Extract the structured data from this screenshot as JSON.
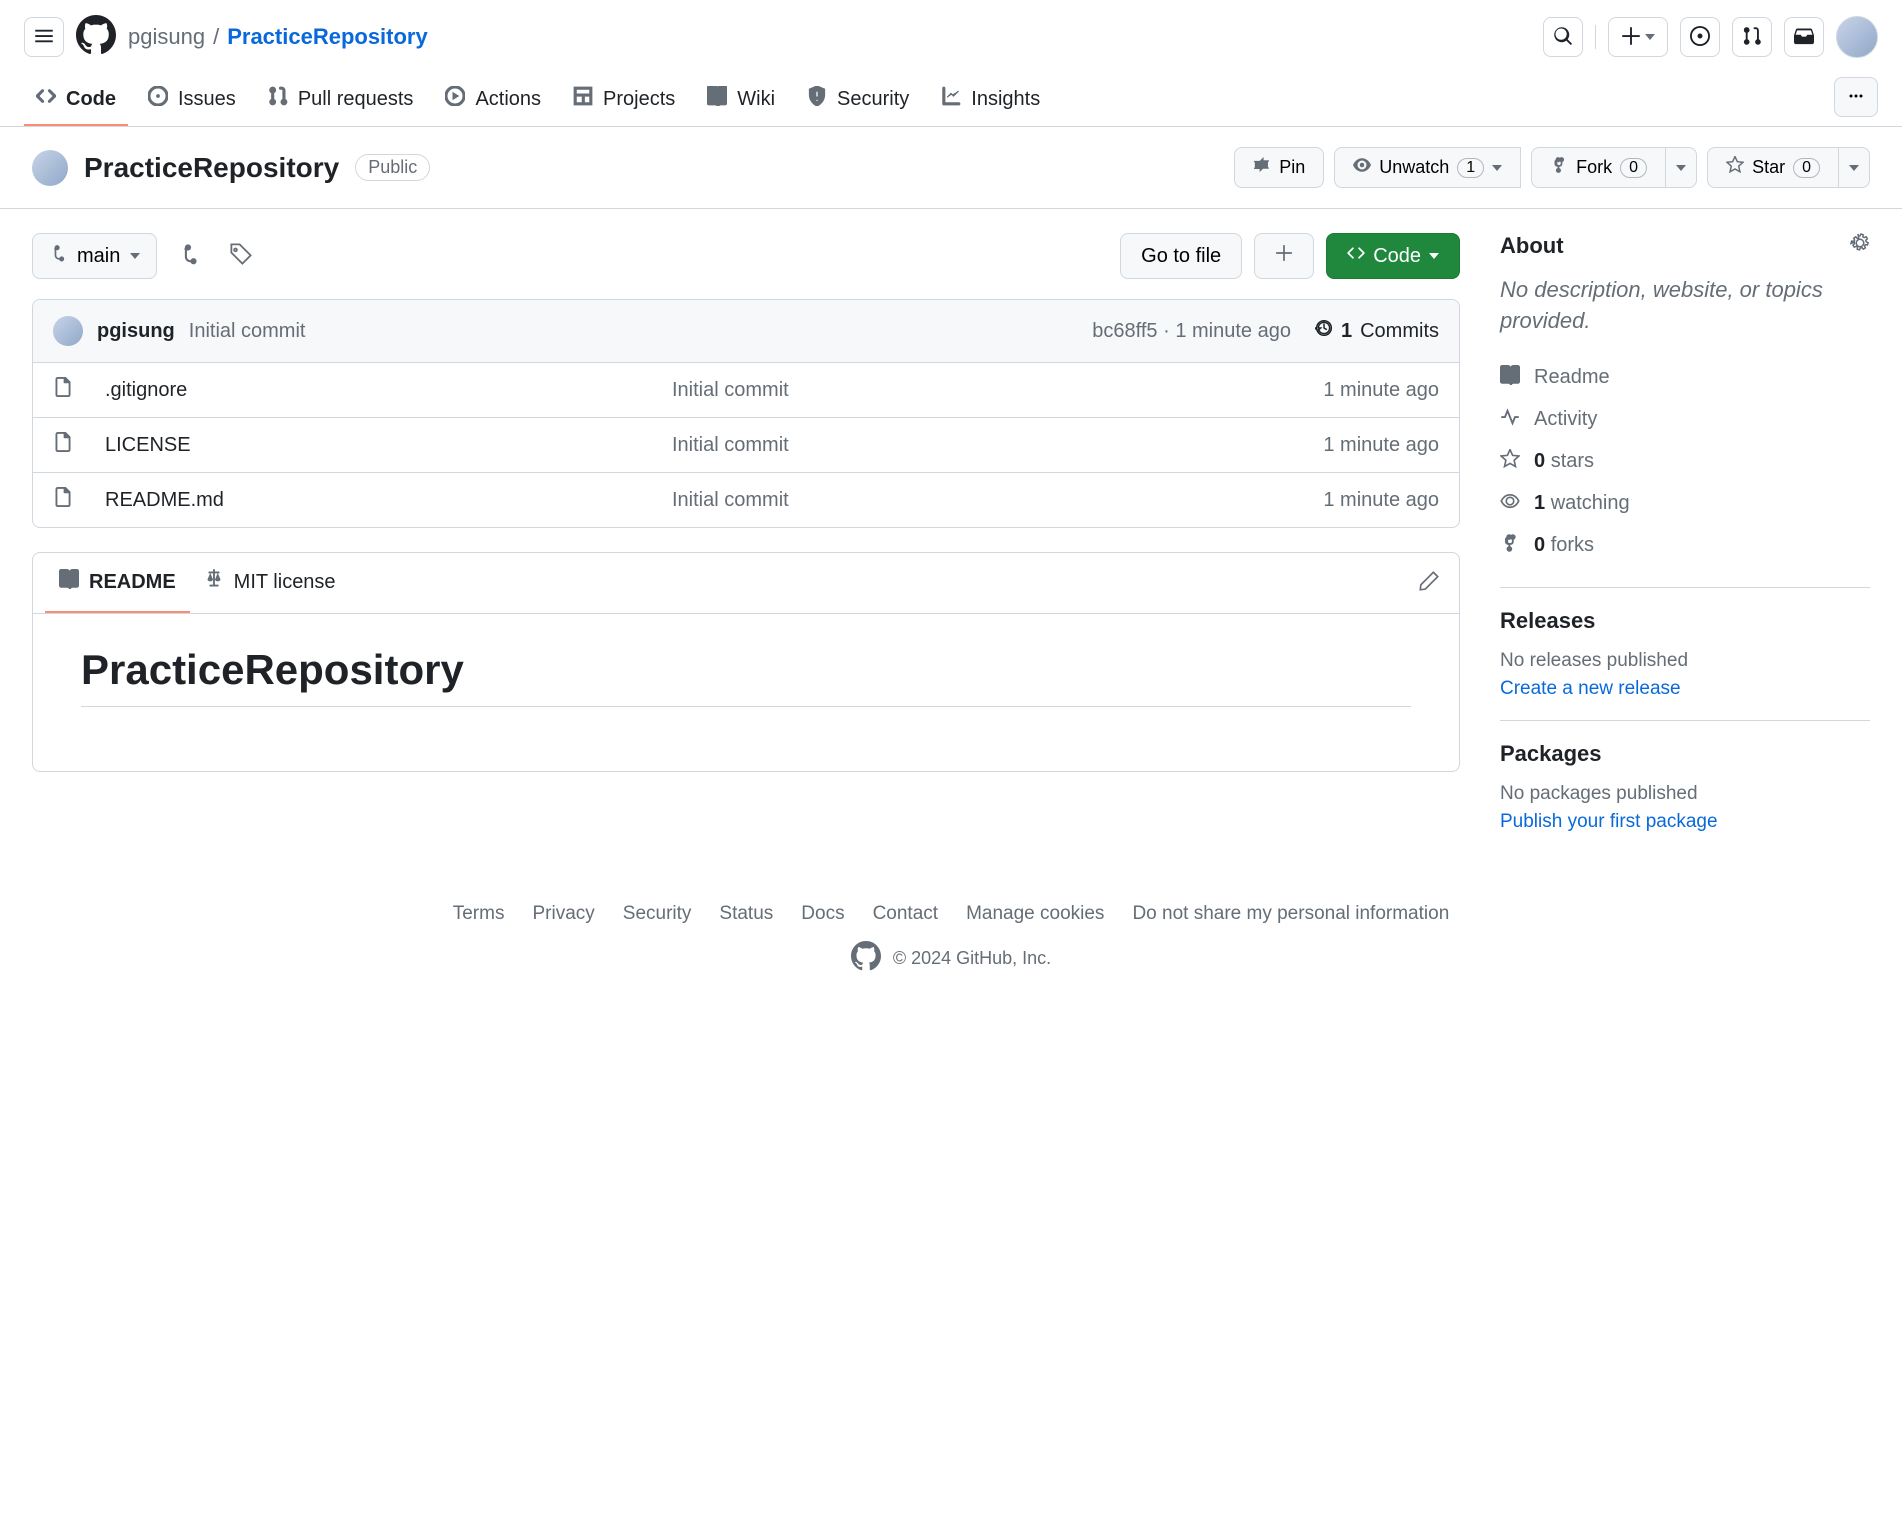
{
  "breadcrumb": {
    "owner": "pgisung",
    "sep": "/",
    "repo": "PracticeRepository"
  },
  "nav": {
    "code": "Code",
    "issues": "Issues",
    "pulls": "Pull requests",
    "actions": "Actions",
    "projects": "Projects",
    "wiki": "Wiki",
    "security": "Security",
    "insights": "Insights"
  },
  "subheader": {
    "title": "PracticeRepository",
    "visibility": "Public",
    "pin": "Pin",
    "unwatch": "Unwatch",
    "unwatch_count": "1",
    "fork": "Fork",
    "fork_count": "0",
    "star": "Star",
    "star_count": "0"
  },
  "file_nav": {
    "branch": "main",
    "go_to_file": "Go to file",
    "code_btn": "Code"
  },
  "commit": {
    "author": "pgisung",
    "message": "Initial commit",
    "sha": "bc68ff5",
    "sep": "·",
    "time": "1 minute ago",
    "count_num": "1",
    "count_label": "Commits"
  },
  "files": [
    {
      "name": ".gitignore",
      "msg": "Initial commit",
      "time": "1 minute ago"
    },
    {
      "name": "LICENSE",
      "msg": "Initial commit",
      "time": "1 minute ago"
    },
    {
      "name": "README.md",
      "msg": "Initial commit",
      "time": "1 minute ago"
    }
  ],
  "readme": {
    "tab_readme": "README",
    "tab_license": "MIT license",
    "heading": "PracticeRepository"
  },
  "about": {
    "title": "About",
    "desc": "No description, website, or topics provided.",
    "readme": "Readme",
    "activity": "Activity",
    "stars_n": "0",
    "stars_l": "stars",
    "watch_n": "1",
    "watch_l": "watching",
    "forks_n": "0",
    "forks_l": "forks"
  },
  "releases": {
    "title": "Releases",
    "none": "No releases published",
    "create": "Create a new release"
  },
  "packages": {
    "title": "Packages",
    "none": "No packages published",
    "publish": "Publish your first package"
  },
  "footer": {
    "links": [
      "Terms",
      "Privacy",
      "Security",
      "Status",
      "Docs",
      "Contact",
      "Manage cookies",
      "Do not share my personal information"
    ],
    "copy": "© 2024 GitHub, Inc."
  }
}
